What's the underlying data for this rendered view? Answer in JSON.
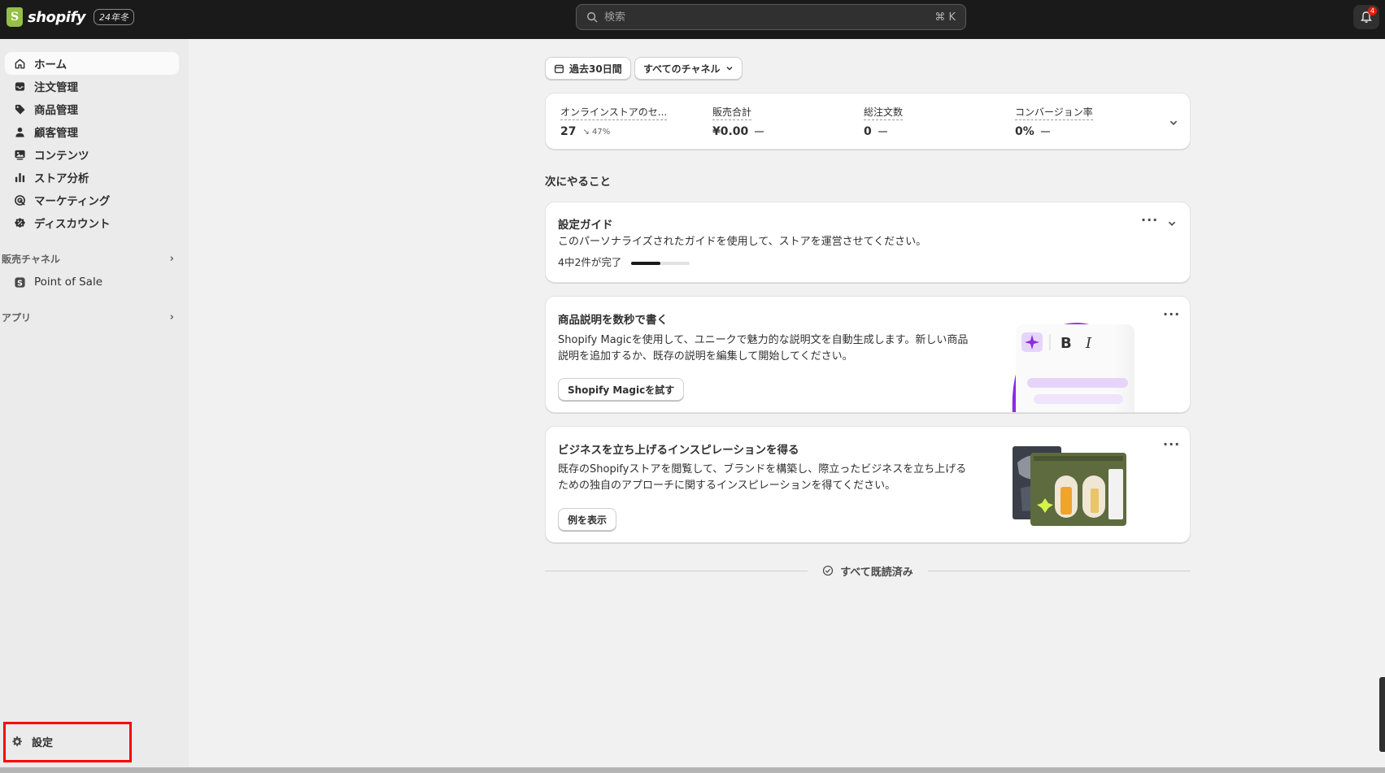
{
  "topbar": {
    "logo_text": "shopify",
    "edition_badge": "24年冬",
    "search_placeholder": "検索",
    "search_shortcut": "⌘ K",
    "notification_count": "4"
  },
  "sidebar": {
    "items": [
      {
        "label": "ホーム",
        "icon": "home-icon"
      },
      {
        "label": "注文管理",
        "icon": "inbox-icon"
      },
      {
        "label": "商品管理",
        "icon": "tag-icon"
      },
      {
        "label": "顧客管理",
        "icon": "person-icon"
      },
      {
        "label": "コンテンツ",
        "icon": "image-icon"
      },
      {
        "label": "ストア分析",
        "icon": "chart-icon"
      },
      {
        "label": "マーケティング",
        "icon": "target-icon"
      },
      {
        "label": "ディスカウント",
        "icon": "discount-icon"
      }
    ],
    "sales_channels_label": "販売チャネル",
    "pos_label": "Point of Sale",
    "apps_label": "アプリ",
    "settings_label": "設定"
  },
  "filters": {
    "date_range": "過去30日間",
    "channel": "すべてのチャネル"
  },
  "metrics": [
    {
      "label": "オンラインストアのセ...",
      "value": "27",
      "change": "↘ 47%"
    },
    {
      "label": "販売合計",
      "value": "¥0.00",
      "change": ""
    },
    {
      "label": "総注文数",
      "value": "0",
      "change": ""
    },
    {
      "label": "コンバージョン率",
      "value": "0%",
      "change": ""
    }
  ],
  "next_section_title": "次にやること",
  "setup_guide": {
    "title": "設定ガイド",
    "description": "このパーソナライズされたガイドを使用して、ストアを運営させてください。",
    "progress_text": "4中2件が完了",
    "progress_fraction": 0.5
  },
  "magic_card": {
    "title": "商品説明を数秒で書く",
    "description_line1": "Shopify Magicを使用して、ユニークで魅力的な説明文を自動生成します。新しい商品",
    "description_line2": "説明を追加するか、既存の説明を編集して開始してください。",
    "button": "Shopify Magicを試す",
    "illus_bold": "B",
    "illus_italic": "I"
  },
  "inspiration_card": {
    "title": "ビジネスを立ち上げるインスピレーションを得る",
    "description_line1": "既存のShopifyストアを閲覧して、ブランドを構築し、際立ったビジネスを立ち上げる",
    "description_line2": "ための独自のアプローチに関するインスピレーションを得てください。",
    "button": "例を表示"
  },
  "all_read_label": "すべて既読済み",
  "colors": {
    "topbar": "#1a1a1a",
    "sidebar": "#ebebeb",
    "main_bg": "#f1f1f1",
    "magic_purple": "#8a2be2",
    "highlight": "#ff0000"
  }
}
